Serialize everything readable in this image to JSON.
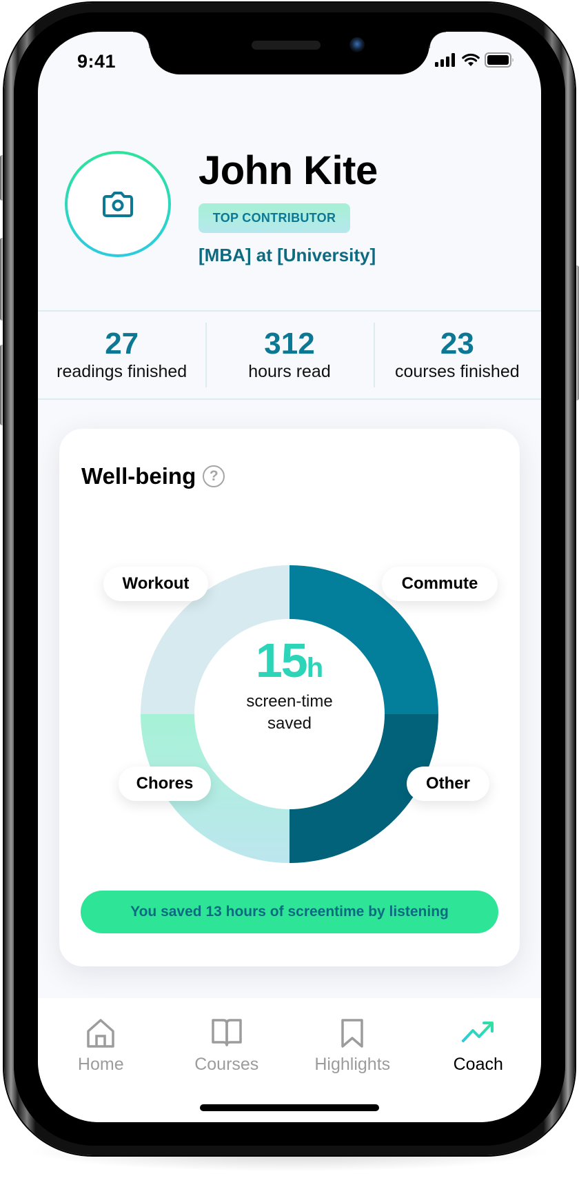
{
  "status_bar": {
    "time": "9:41",
    "icons": [
      "signal-icon",
      "wifi-icon",
      "battery-icon"
    ]
  },
  "profile": {
    "avatar_icon": "camera-icon",
    "name": "John Kite",
    "badge": "TOP CONTRIBUTOR",
    "affiliation": "[MBA] at [University]"
  },
  "stats": [
    {
      "value": "27",
      "label": "readings finished"
    },
    {
      "value": "312",
      "label": "hours read"
    },
    {
      "value": "23",
      "label": "courses finished"
    }
  ],
  "wellbeing": {
    "title": "Well-being",
    "help_icon": "question-circle-icon",
    "help_glyph": "?",
    "center_value": "15",
    "center_unit": "h",
    "center_label_line1": "screen-time",
    "center_label_line2": "saved",
    "banner": "You saved 13 hours of screentime by listening"
  },
  "chart_data": {
    "type": "pie",
    "title": "Well-being",
    "center_text": "15h screen-time saved",
    "categories": [
      "Commute",
      "Other",
      "Chores",
      "Workout"
    ],
    "values": [
      25,
      25,
      25,
      25
    ],
    "colors": [
      "#037e9b",
      "#01627a",
      "#b3ece1",
      "#d6eaef"
    ],
    "chores_gradient": [
      "#a6f2d6",
      "#bde6ee"
    ],
    "legend": "labels on slices"
  },
  "tabbar": {
    "items": [
      {
        "label": "Home",
        "icon": "home-icon",
        "active": false
      },
      {
        "label": "Courses",
        "icon": "book-icon",
        "active": false
      },
      {
        "label": "Highlights",
        "icon": "bookmark-icon",
        "active": false
      },
      {
        "label": "Coach",
        "icon": "trending-up-icon",
        "active": true
      }
    ]
  },
  "colors": {
    "accent": "#0c7893",
    "success": "#2ee597",
    "gradient_start": "#2fe39a",
    "gradient_end": "#2ccbe0",
    "inactive": "#9c9c9c"
  }
}
